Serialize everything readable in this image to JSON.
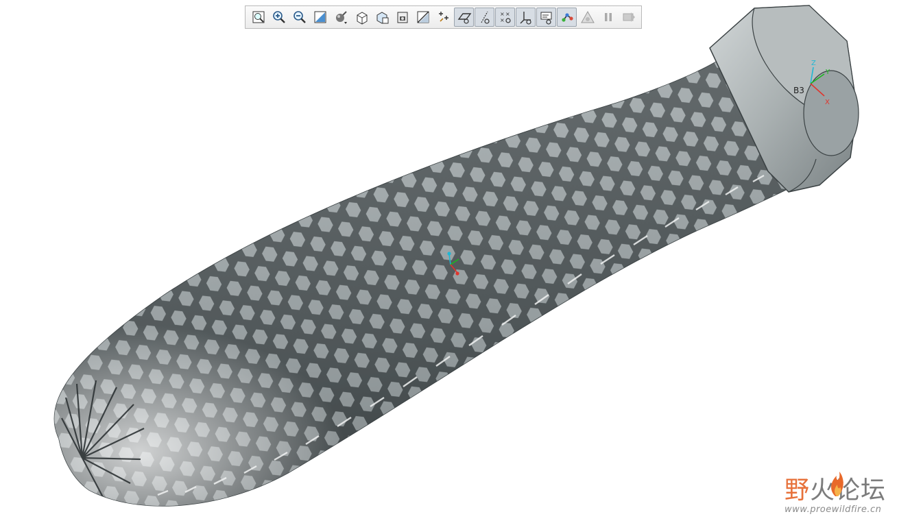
{
  "toolbar": {
    "buttons": [
      {
        "id": "refit",
        "icon": "refit-icon",
        "active": false
      },
      {
        "id": "zoom-in",
        "icon": "zoom-in-icon",
        "active": false
      },
      {
        "id": "zoom-out",
        "icon": "zoom-out-icon",
        "active": false
      },
      {
        "id": "repaint",
        "icon": "repaint-icon",
        "active": false
      },
      {
        "id": "display-style",
        "icon": "display-style-icon",
        "active": false
      },
      {
        "id": "saved-orientations",
        "icon": "saved-views-icon",
        "active": false
      },
      {
        "id": "view-manager",
        "icon": "view-manager-icon",
        "active": false
      },
      {
        "id": "perspective",
        "icon": "perspective-icon",
        "active": false
      },
      {
        "id": "section",
        "icon": "section-icon",
        "active": false
      },
      {
        "id": "spin-center",
        "icon": "spin-center-icon",
        "active": false
      },
      {
        "id": "plane-display",
        "icon": "plane-display-icon",
        "active": true
      },
      {
        "id": "axis-display",
        "icon": "axis-display-icon",
        "active": true
      },
      {
        "id": "point-display",
        "icon": "point-display-icon",
        "active": true
      },
      {
        "id": "csys-display",
        "icon": "csys-display-icon",
        "active": true
      },
      {
        "id": "annotation-display",
        "icon": "annotation-display-icon",
        "active": true
      },
      {
        "id": "spin-center-display",
        "icon": "spin-center-display-icon",
        "active": true
      },
      {
        "id": "appearance",
        "icon": "appearance-icon",
        "active": false
      },
      {
        "id": "pause",
        "icon": "pause-icon",
        "active": false
      },
      {
        "id": "next",
        "icon": "next-icon",
        "active": false
      }
    ]
  },
  "model": {
    "csys_label": "B3",
    "axis_labels": {
      "x": "X",
      "y": "Y",
      "z": "Z"
    },
    "colors": {
      "body": "#98a0a2",
      "body_light": "#c6cccd",
      "body_dark": "#4b5254",
      "rib": "#2e3436",
      "axis_x": "#e0342c",
      "axis_y": "#1bb81f",
      "axis_z": "#1fb7d4"
    }
  },
  "watermark": {
    "title_first": "野",
    "title_rest": "火论坛",
    "url": "www.proewildfire.cn"
  }
}
